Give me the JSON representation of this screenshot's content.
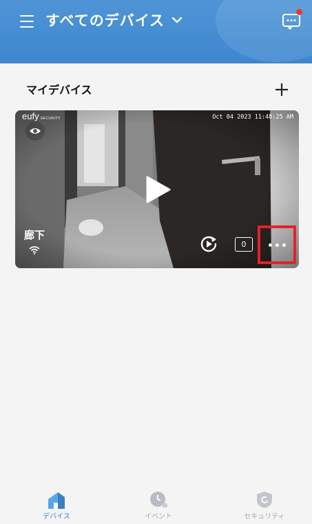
{
  "header": {
    "title": "すべてのデバイス",
    "has_notification": true
  },
  "section": {
    "title": "マイデバイス"
  },
  "device_card": {
    "brand_logo": "eufy",
    "brand_sub": "SECURITY",
    "timestamp": "Oct 04 2023  11:48:25 AM",
    "device_name": "廊下",
    "event_count": "0",
    "icons": [
      "eye-icon",
      "play-icon",
      "wifi-icon",
      "replay-icon",
      "more-icon"
    ],
    "highlight_color": "#e4212b"
  },
  "bottom_nav": {
    "items": [
      {
        "label": "デバイス",
        "icon": "home-icon",
        "active": true
      },
      {
        "label": "イベント",
        "icon": "clock-icon",
        "active": false
      },
      {
        "label": "セキュリティ",
        "icon": "shield-icon",
        "active": false
      }
    ]
  },
  "colors": {
    "header_bg": "#4b91d4",
    "accent": "#3b82c4",
    "highlight": "#e4212b"
  }
}
